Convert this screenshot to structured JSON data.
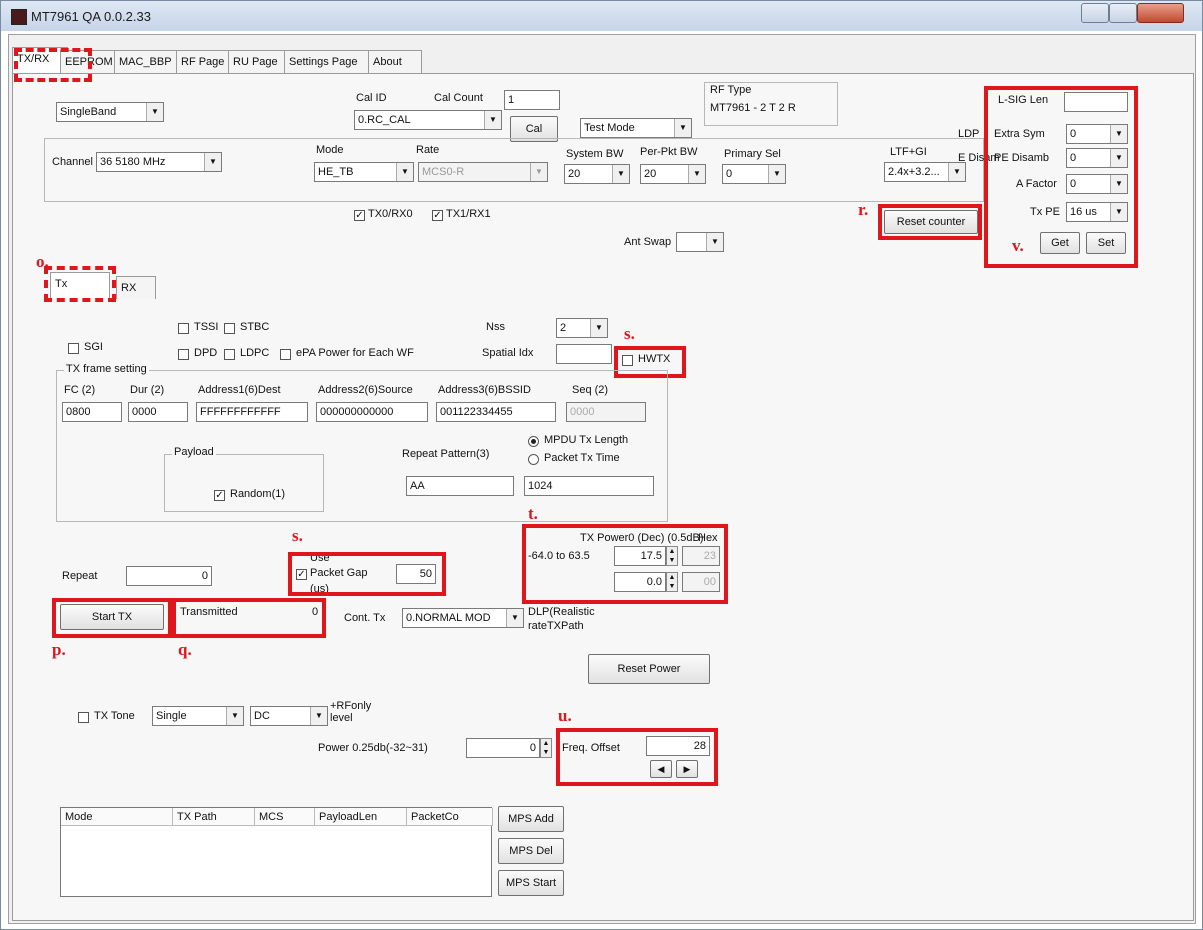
{
  "window": {
    "title": "MT7961 QA 0.0.2.33"
  },
  "tabs": [
    "TX/RX",
    "EEPROM",
    "MAC_BBP",
    "RF Page",
    "RU Page",
    "Settings Page",
    "About"
  ],
  "top": {
    "band": "SingleBand",
    "cal_id_label": "Cal ID",
    "cal_id": "0.RC_CAL",
    "cal_count_label": "Cal Count",
    "cal_count": "1",
    "cal_button": "Cal",
    "test_mode": "Test Mode",
    "rf_type_label": "RF Type",
    "rf_type": "MT7961 - 2 T 2 R",
    "channel_label": "Channel",
    "channel": "36 5180 MHz",
    "mode_label": "Mode",
    "mode": "HE_TB",
    "rate_label": "Rate",
    "rate": "MCS0-R",
    "system_bw_label": "System BW",
    "system_bw": "20",
    "per_pkt_bw_label": "Per-Pkt BW",
    "per_pkt_bw": "20",
    "primary_sel_label": "Primary Sel",
    "primary_sel": "0",
    "ltf_gi_label": "LTF+GI",
    "ltf_gi": "2.4x+3.2...",
    "tx0rx0": "TX0/RX0",
    "tx1rx1": "TX1/RX1",
    "ant_swap_label": "Ant Swap",
    "ldp_label": "LDP",
    "e_disam_label": "E Disam",
    "reset_counter": "Reset counter"
  },
  "he_panel": {
    "lsig_len_label": "L-SIG Len",
    "extra_sym_label": "Extra Sym",
    "extra_sym": "0",
    "pe_disamb_label": "PE Disamb",
    "pe_disamb": "0",
    "a_factor_label": "A Factor",
    "a_factor": "0",
    "tx_pe_label": "Tx PE",
    "tx_pe": "16 us",
    "get_button": "Get",
    "set_button": "Set"
  },
  "subtabs": [
    "Tx",
    "RX"
  ],
  "tx": {
    "sgi": "SGI",
    "tssi": "TSSI",
    "stbc": "STBC",
    "dpd": "DPD",
    "ldpc": "LDPC",
    "epa": "ePA Power for Each WF",
    "nss_label": "Nss",
    "nss": "2",
    "spatial_idx_label": "Spatial Idx",
    "hwtx": "HWTX",
    "frame_setting_label": "TX frame setting",
    "frame_headers": [
      "FC (2)",
      "Dur (2)",
      "Address1(6)Dest",
      "Address2(6)Source",
      "Address3(6)BSSID",
      "Seq (2)"
    ],
    "frame_values": [
      "0800",
      "0000",
      "FFFFFFFFFFFF",
      "000000000000",
      "001122334455",
      "0000"
    ],
    "payload_label": "Payload",
    "random_label": "Random(1)",
    "repeat_pattern_label": "Repeat Pattern(3)",
    "repeat_pattern": "AA",
    "mpdu_len_label": "MPDU Tx Length",
    "packet_tx_time_label": "Packet Tx Time",
    "mpdu_len": "1024",
    "repeat_label": "Repeat",
    "repeat": "0",
    "use_label": "Use",
    "packet_gap_label": "Packet Gap",
    "packet_gap": "50",
    "packet_gap_unit": "(us)",
    "tx_power_header": "TX Power0 (Dec) (0.5dB)",
    "hex_label": "Hex",
    "range_label": "-64.0 to 63.5",
    "power0": "17.5",
    "power0_hex": "23",
    "power1": "0.0",
    "power1_hex": "00",
    "start_tx": "Start TX",
    "transmitted_label": "Transmitted",
    "transmitted": "0",
    "cont_tx_label": "Cont. Tx",
    "cont_tx": "0.NORMAL MOD",
    "dlpd_note": "DLP(Realistic",
    "rate_tx_path": "rateTXPath",
    "reset_power": "Reset Power",
    "tx_tone_label": "TX Tone",
    "tone_type": "Single",
    "tone_dc": "DC",
    "rf_only_label": "+RFonly",
    "level_label": "level",
    "power_label": "Power 0.25db(-32~31)",
    "power_value": "0",
    "freq_offset_label": "Freq. Offset",
    "freq_offset": "28",
    "list_headers": [
      "Mode",
      "TX Path",
      "MCS",
      "PayloadLen",
      "PacketCo"
    ],
    "mps_add": "MPS Add",
    "mps_del": "MPS Del",
    "mps_start": "MPS Start"
  },
  "annotations": [
    "o.",
    "p.",
    "q.",
    "r.",
    "s.",
    "s.",
    "t.",
    "u.",
    "v."
  ],
  "colors": {
    "highlight": "#e0161d",
    "title_gradient_top": "#dfe8f4"
  }
}
